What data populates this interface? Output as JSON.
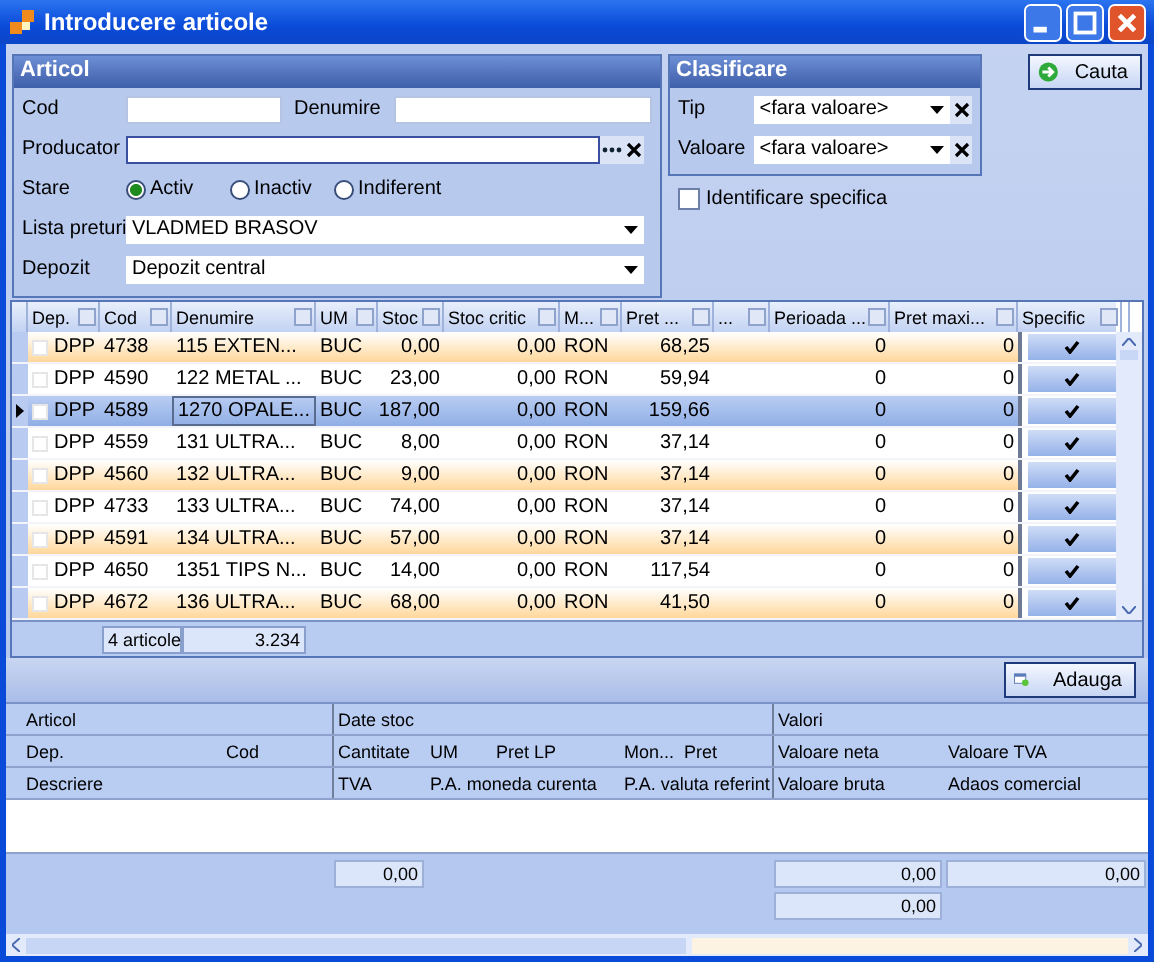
{
  "window": {
    "title": "Introducere articole"
  },
  "articol": {
    "title": "Articol",
    "cod_label": "Cod",
    "denumire_label": "Denumire",
    "producator_label": "Producator",
    "stare_label": "Stare",
    "stare_options": [
      {
        "label": "Activ",
        "selected": true
      },
      {
        "label": "Inactiv",
        "selected": false
      },
      {
        "label": "Indiferent",
        "selected": false
      }
    ],
    "lista_preturi": {
      "label": "Lista preturi",
      "value": "VLADMED BRASOV"
    },
    "depozit": {
      "label": "Depozit",
      "value": "Depozit central"
    }
  },
  "clasificare": {
    "title": "Clasificare",
    "fields": [
      {
        "label": "Tip",
        "value": "<fara valoare>"
      },
      {
        "label": "Valoare",
        "value": "<fara valoare>"
      }
    ]
  },
  "identificare_specifica": {
    "label": "Identificare specifica",
    "checked": false
  },
  "search_button": "Cauta",
  "grid": {
    "columns": [
      "Dep.",
      "Cod",
      "Denumire",
      "UM",
      "Stoc",
      "Stoc critic",
      "M...",
      "Pret ...",
      "...",
      "Perioada ...",
      "Pret maxi...",
      "Specific"
    ],
    "rows": [
      {
        "cells": [
          "DPP",
          "4738",
          "115  EXTEN...",
          "BUC",
          "0,00",
          "0,00",
          "RON",
          "68,25",
          "",
          "0",
          "0"
        ],
        "specific": true,
        "selected": false
      },
      {
        "cells": [
          "DPP",
          "4590",
          "122  METAL ...",
          "BUC",
          "23,00",
          "0,00",
          "RON",
          "59,94",
          "",
          "0",
          "0"
        ],
        "specific": true,
        "selected": false
      },
      {
        "cells": [
          "DPP",
          "4589",
          "1270 OPALE...",
          "BUC",
          "187,00",
          "0,00",
          "RON",
          "159,66",
          "",
          "0",
          "0"
        ],
        "specific": true,
        "selected": true
      },
      {
        "cells": [
          "DPP",
          "4559",
          "131  ULTRA...",
          "BUC",
          "8,00",
          "0,00",
          "RON",
          "37,14",
          "",
          "0",
          "0"
        ],
        "specific": true,
        "selected": false
      },
      {
        "cells": [
          "DPP",
          "4560",
          "132  ULTRA...",
          "BUC",
          "9,00",
          "0,00",
          "RON",
          "37,14",
          "",
          "0",
          "0"
        ],
        "specific": true,
        "selected": false
      },
      {
        "cells": [
          "DPP",
          "4733",
          "133  ULTRA...",
          "BUC",
          "74,00",
          "0,00",
          "RON",
          "37,14",
          "",
          "0",
          "0"
        ],
        "specific": true,
        "selected": false
      },
      {
        "cells": [
          "DPP",
          "4591",
          "134  ULTRA...",
          "BUC",
          "57,00",
          "0,00",
          "RON",
          "37,14",
          "",
          "0",
          "0"
        ],
        "specific": true,
        "selected": false
      },
      {
        "cells": [
          "DPP",
          "4650",
          "1351 TIPS N...",
          "BUC",
          "14,00",
          "0,00",
          "RON",
          "117,54",
          "",
          "0",
          "0"
        ],
        "specific": true,
        "selected": false
      },
      {
        "cells": [
          "DPP",
          "4672",
          "136  ULTRA...",
          "BUC",
          "68,00",
          "0,00",
          "RON",
          "41,50",
          "",
          "0",
          "0"
        ],
        "specific": true,
        "selected": false
      }
    ],
    "footer": {
      "count": "4 articole",
      "total": "3.234"
    }
  },
  "add_button": "Adauga",
  "detail": {
    "groups": [
      "Articol",
      "Date stoc",
      "Valori"
    ],
    "row_1": [
      "Dep.",
      "Cod",
      "Cantitate",
      "UM",
      "Pret LP",
      "Mon...",
      "Pret",
      "Valoare neta",
      "Valoare TVA"
    ],
    "row_2": [
      "Descriere",
      "TVA",
      "P.A. moneda curenta",
      "P.A. valuta referint",
      "Valoare bruta",
      "Adaos comercial"
    ],
    "totals": {
      "cantitate": "0,00",
      "valoare_neta": "0,00",
      "valoare_tva": "0,00",
      "valoare_bruta": "0,00"
    }
  }
}
